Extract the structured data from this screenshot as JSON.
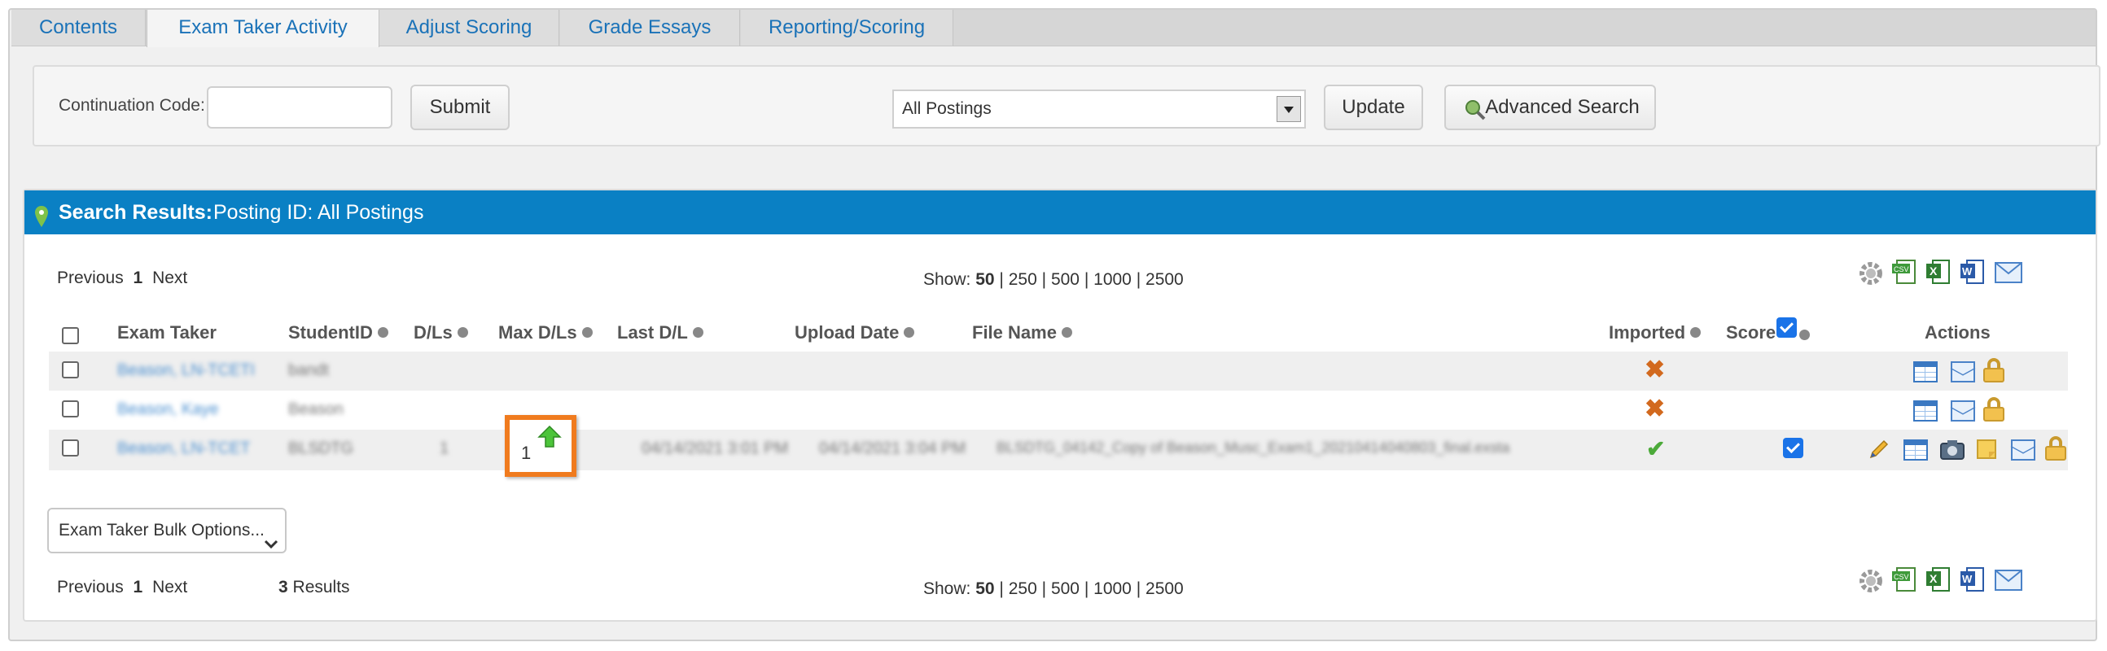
{
  "tabs": [
    {
      "label": "Contents"
    },
    {
      "label": "Exam Taker Activity",
      "active": true
    },
    {
      "label": "Adjust Scoring"
    },
    {
      "label": "Grade Essays"
    },
    {
      "label": "Reporting/Scoring"
    }
  ],
  "toolbar": {
    "continuation_label": "Continuation Code:",
    "continuation_value": "",
    "submit_label": "Submit",
    "posting_select": "All Postings",
    "update_label": "Update",
    "advanced_search_label": "Advanced Search"
  },
  "results": {
    "header_title": "Search Results:",
    "header_subtitle": "Posting ID: All Postings",
    "pager_top": {
      "prev": "Previous",
      "page": "1",
      "next": "Next"
    },
    "pager_bottom": {
      "prev": "Previous",
      "page": "1",
      "next": "Next",
      "count": "3",
      "results_label": "Results"
    },
    "show": {
      "label": "Show:",
      "options": [
        "50",
        "250",
        "500",
        "1000",
        "2500"
      ],
      "selected": "50"
    },
    "columns": {
      "exam_taker": "Exam Taker",
      "student_id": "StudentID",
      "dls": "D/Ls",
      "max_dls": "Max D/Ls",
      "last_dl": "Last D/L",
      "upload_date": "Upload Date",
      "file_name": "File Name",
      "imported": "Imported",
      "score": "Score",
      "actions": "Actions"
    },
    "rows": [
      {
        "exam_taker": "Beason, LN-TCETI",
        "student_id": "bandt",
        "dls": "",
        "max_dls": "",
        "last_dl": "",
        "upload_date": "",
        "file_name": "",
        "imported": "no"
      },
      {
        "exam_taker": "Beason, Kaye",
        "student_id": "Beason",
        "dls": "",
        "max_dls": "",
        "last_dl": "",
        "upload_date": "",
        "file_name": "",
        "imported": "no"
      },
      {
        "exam_taker": "Beason, LN-TCET",
        "student_id": "BLSDTG",
        "dls": "1",
        "max_dls": "1",
        "last_dl": "04/14/2021 3:01 PM",
        "upload_date": "04/14/2021 3:04 PM",
        "file_name": "BLSDTG_04142_Copy of Beason_Musc_Exam1_20210414040803_final.exsta",
        "imported": "yes",
        "score_checked": true
      }
    ],
    "bulk_options": "Exam Taker Bulk Options...",
    "separator": "|"
  },
  "icons": {
    "settings": "gear-icon",
    "csv": "csv-icon",
    "excel": "excel-icon",
    "word": "word-icon",
    "email": "mail-icon"
  },
  "colors": {
    "header_bar": "#0a80c4",
    "tab_link": "#1a72b8",
    "callout": "#f07b1e"
  }
}
